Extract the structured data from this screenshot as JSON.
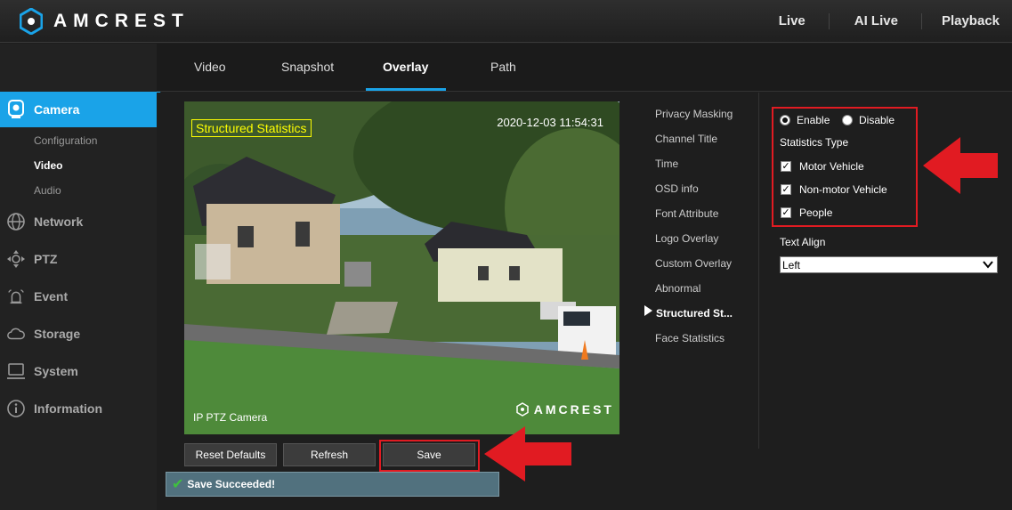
{
  "app": {
    "brand": "AMCREST"
  },
  "topnav": {
    "items": [
      "Live",
      "AI Live",
      "Playback"
    ]
  },
  "tabs": [
    "Video",
    "Snapshot",
    "Overlay",
    "Path"
  ],
  "active_tab": "Overlay",
  "sidebar": {
    "items": [
      {
        "label": "Camera",
        "icon": "camera-icon",
        "active": true
      },
      {
        "label": "Network",
        "icon": "globe-icon"
      },
      {
        "label": "PTZ",
        "icon": "ptz-icon"
      },
      {
        "label": "Event",
        "icon": "alarm-icon"
      },
      {
        "label": "Storage",
        "icon": "cloud-icon"
      },
      {
        "label": "System",
        "icon": "monitor-icon"
      },
      {
        "label": "Information",
        "icon": "info-icon"
      }
    ],
    "camera_sub": [
      "Configuration",
      "Video",
      "Audio"
    ],
    "active_sub": "Video"
  },
  "preview": {
    "osd_title": "Structured Statistics",
    "osd_time": "2020-12-03 11:54:31",
    "osd_channel": "IP PTZ Camera",
    "osd_logo": "AMCREST"
  },
  "buttons": {
    "reset": "Reset Defaults",
    "refresh": "Refresh",
    "save": "Save"
  },
  "status": {
    "message": "Save Succeeded!"
  },
  "overlay_menu": [
    "Privacy Masking",
    "Channel Title",
    "Time",
    "OSD info",
    "Font Attribute",
    "Logo Overlay",
    "Custom Overlay",
    "Abnormal",
    "Structured St...",
    "Face Statistics"
  ],
  "overlay_menu_active_index": 8,
  "settings": {
    "enable_label": "Enable",
    "disable_label": "Disable",
    "enabled": true,
    "statistics_type_label": "Statistics Type",
    "types": [
      {
        "label": "Motor Vehicle",
        "checked": true
      },
      {
        "label": "Non-motor Vehicle",
        "checked": true
      },
      {
        "label": "People",
        "checked": true
      }
    ],
    "text_align_label": "Text Align",
    "text_align_value": "Left"
  },
  "colors": {
    "accent": "#1aa3e8",
    "highlight": "#e11b22",
    "status_bg": "#51717e"
  }
}
